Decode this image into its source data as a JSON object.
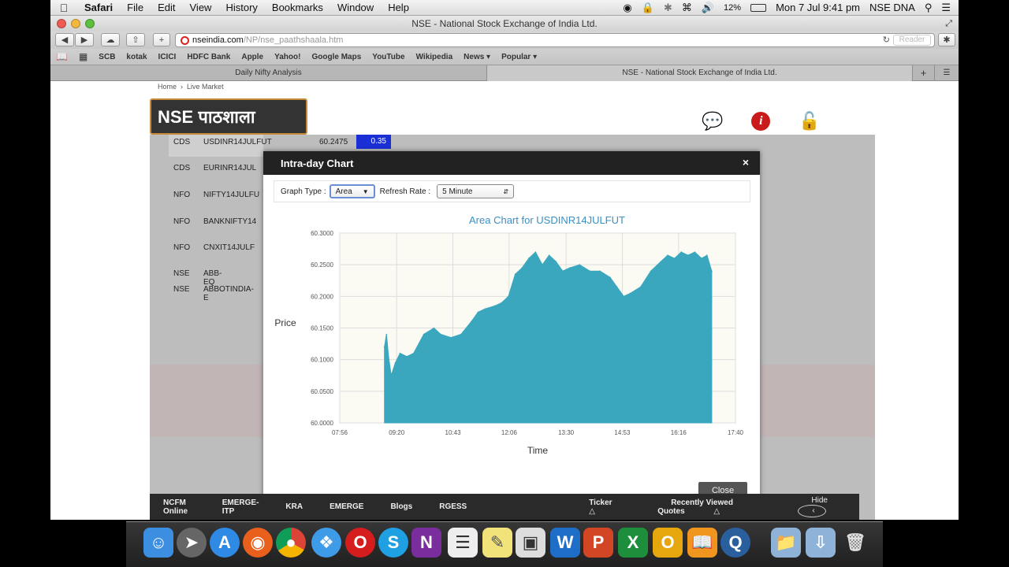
{
  "menubar": {
    "apple": "",
    "app": "Safari",
    "items": [
      "File",
      "Edit",
      "View",
      "History",
      "Bookmarks",
      "Window",
      "Help"
    ],
    "battery": "12%",
    "datetime": "Mon 7 Jul  9:41 pm",
    "user": "NSE DNA"
  },
  "window": {
    "title": "NSE - National Stock Exchange of India Ltd."
  },
  "toolbar": {
    "url_domain": "nseindia.com",
    "url_path": "/NP/nse_paathshaala.htm",
    "reader": "Reader"
  },
  "bookmarks": [
    "SCB",
    "kotak",
    "ICICI",
    "HDFC Bank",
    "Apple",
    "Yahoo!",
    "Google Maps",
    "YouTube",
    "Wikipedia",
    "News ▾",
    "Popular ▾"
  ],
  "tabs": [
    {
      "label": "Daily Nifty Analysis"
    },
    {
      "label": "NSE - National Stock Exchange of India Ltd."
    }
  ],
  "page": {
    "breadcrumb_home": "Home",
    "breadcrumb_sep": "›",
    "breadcrumb_live": "Live Market",
    "logo_text": "NSE पाठशाला"
  },
  "table": [
    {
      "seg": "CDS",
      "sym": "USDINR14JULFUT",
      "price": "60.2475",
      "chg": "0.35"
    },
    {
      "seg": "CDS",
      "sym": "EURINR14JUL"
    },
    {
      "seg": "NFO",
      "sym": "NIFTY14JULFU"
    },
    {
      "seg": "NFO",
      "sym": "BANKNIFTY14"
    },
    {
      "seg": "NFO",
      "sym": "CNXIT14JULF"
    },
    {
      "seg": "NSE",
      "sym": "ABB-EQ"
    },
    {
      "seg": "NSE",
      "sym": "ABBOTINDIA-E"
    }
  ],
  "modal": {
    "title": "Intra-day Chart",
    "close_x": "×",
    "graph_type_label": "Graph Type :",
    "graph_type_value": "Area",
    "refresh_rate_label": "Refresh Rate :",
    "refresh_rate_value": "5 Minute",
    "close_button": "Close"
  },
  "chart_data": {
    "type": "area",
    "title": "Area Chart for USDINR14JULFUT",
    "xlabel": "Time",
    "ylabel": "Price",
    "ylim": [
      60.0,
      60.3
    ],
    "yticks": [
      "60.0000",
      "60.0500",
      "60.1000",
      "60.1500",
      "60.2000",
      "60.2500",
      "60.3000"
    ],
    "xticks": [
      "07:56",
      "09:20",
      "10:43",
      "12:06",
      "13:30",
      "14:53",
      "16:16",
      "17:40"
    ],
    "color": "#3aa7bf",
    "grid": true,
    "series": [
      {
        "x": [
          "09:02",
          "09:05",
          "09:08",
          "09:12",
          "09:18",
          "09:25",
          "09:35",
          "09:45",
          "10:00",
          "10:15",
          "10:25",
          "10:40",
          "10:55",
          "11:10",
          "11:20",
          "11:30",
          "11:45",
          "11:55",
          "12:05",
          "12:15",
          "12:25",
          "12:35",
          "12:45",
          "12:55",
          "13:05",
          "13:15",
          "13:25",
          "13:35",
          "13:50",
          "14:05",
          "14:20",
          "14:35",
          "14:45",
          "14:55",
          "15:05",
          "15:20",
          "15:35",
          "15:50",
          "16:00",
          "16:10",
          "16:20",
          "16:30",
          "16:40",
          "16:50",
          "16:58",
          "17:05"
        ],
        "values": [
          60.12,
          60.14,
          60.105,
          60.075,
          60.095,
          60.11,
          60.105,
          60.11,
          60.14,
          60.15,
          60.14,
          60.135,
          60.14,
          60.16,
          60.175,
          60.18,
          60.185,
          60.19,
          60.2,
          60.235,
          60.245,
          60.26,
          60.27,
          60.25,
          60.265,
          60.255,
          60.24,
          60.245,
          60.25,
          60.24,
          60.24,
          60.23,
          60.215,
          60.2,
          60.205,
          60.215,
          60.24,
          60.255,
          60.265,
          60.26,
          60.27,
          60.265,
          60.27,
          60.26,
          60.265,
          60.24
        ]
      }
    ]
  },
  "bottombar": {
    "items": [
      "NCFM Online",
      "EMERGE-ITP",
      "KRA",
      "EMERGE",
      "Blogs",
      "RGESS"
    ],
    "ticker": "Ticker",
    "recent": "Recently Viewed Quotes",
    "hide": "Hide"
  },
  "colors": {
    "accent": "#3aa7bf",
    "modal_header": "#222222",
    "logo_border": "#c8893a",
    "change_badge": "#1a2fd6"
  }
}
